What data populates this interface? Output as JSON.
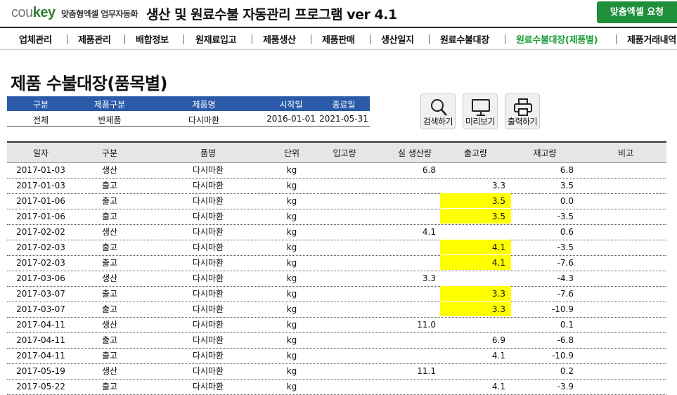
{
  "header": {
    "logo_a": "cou",
    "logo_b": "key",
    "logo_sub": "맞춤형엑셀 업무자동화",
    "app_title": "생산 및 원료수불 자동관리 프로그램 ver 4.1",
    "request_button": "맞춤엑셀 요청"
  },
  "nav": [
    {
      "label": "업체관리",
      "active": false
    },
    {
      "label": "제품관리",
      "active": false
    },
    {
      "label": "배합정보",
      "active": false
    },
    {
      "label": "원재료입고",
      "active": false
    },
    {
      "label": "제품생산",
      "active": false
    },
    {
      "label": "제품판매",
      "active": false
    },
    {
      "label": "생산일지",
      "active": false
    },
    {
      "label": "원료수불대장",
      "active": false
    },
    {
      "label": "원료수불대장(제품별)",
      "active": true
    },
    {
      "label": "제품거래내역",
      "active": false
    }
  ],
  "page_title": "제품 수불대장(품목별)",
  "filter": {
    "headers": [
      "구분",
      "제품구분",
      "제품명",
      "시작일",
      "종료일"
    ],
    "values": [
      "전체",
      "반제품",
      "다시마환",
      "2016-01-01",
      "2021-05-31"
    ]
  },
  "tools": {
    "search": "검색하기",
    "preview": "미리보기",
    "print": "출력하기"
  },
  "table": {
    "columns": [
      "일자",
      "구분",
      "품명",
      "단위",
      "입고량",
      "실 생산량",
      "출고량",
      "재고량",
      "비고"
    ],
    "highlight_color": "#ffff00",
    "rows": [
      {
        "date": "2017-01-03",
        "type": "생산",
        "name": "다시마환",
        "unit": "kg",
        "in": "",
        "prod": "6.8",
        "out": "",
        "stock": "6.8",
        "note": "",
        "hl": false
      },
      {
        "date": "2017-01-03",
        "type": "출고",
        "name": "다시마환",
        "unit": "kg",
        "in": "",
        "prod": "",
        "out": "3.3",
        "stock": "3.5",
        "note": "",
        "hl": false
      },
      {
        "date": "2017-01-06",
        "type": "출고",
        "name": "다시마환",
        "unit": "kg",
        "in": "",
        "prod": "",
        "out": "3.5",
        "stock": "0.0",
        "note": "",
        "hl": true
      },
      {
        "date": "2017-01-06",
        "type": "출고",
        "name": "다시마환",
        "unit": "kg",
        "in": "",
        "prod": "",
        "out": "3.5",
        "stock": "-3.5",
        "note": "",
        "hl": true
      },
      {
        "date": "2017-02-02",
        "type": "생산",
        "name": "다시마환",
        "unit": "kg",
        "in": "",
        "prod": "4.1",
        "out": "",
        "stock": "0.6",
        "note": "",
        "hl": false
      },
      {
        "date": "2017-02-03",
        "type": "출고",
        "name": "다시마환",
        "unit": "kg",
        "in": "",
        "prod": "",
        "out": "4.1",
        "stock": "-3.5",
        "note": "",
        "hl": true
      },
      {
        "date": "2017-02-03",
        "type": "출고",
        "name": "다시마환",
        "unit": "kg",
        "in": "",
        "prod": "",
        "out": "4.1",
        "stock": "-7.6",
        "note": "",
        "hl": true
      },
      {
        "date": "2017-03-06",
        "type": "생산",
        "name": "다시마환",
        "unit": "kg",
        "in": "",
        "prod": "3.3",
        "out": "",
        "stock": "-4.3",
        "note": "",
        "hl": false
      },
      {
        "date": "2017-03-07",
        "type": "출고",
        "name": "다시마환",
        "unit": "kg",
        "in": "",
        "prod": "",
        "out": "3.3",
        "stock": "-7.6",
        "note": "",
        "hl": true
      },
      {
        "date": "2017-03-07",
        "type": "출고",
        "name": "다시마환",
        "unit": "kg",
        "in": "",
        "prod": "",
        "out": "3.3",
        "stock": "-10.9",
        "note": "",
        "hl": true
      },
      {
        "date": "2017-04-11",
        "type": "생산",
        "name": "다시마환",
        "unit": "kg",
        "in": "",
        "prod": "11.0",
        "out": "",
        "stock": "0.1",
        "note": "",
        "hl": false
      },
      {
        "date": "2017-04-11",
        "type": "출고",
        "name": "다시마환",
        "unit": "kg",
        "in": "",
        "prod": "",
        "out": "6.9",
        "stock": "-6.8",
        "note": "",
        "hl": false
      },
      {
        "date": "2017-04-11",
        "type": "출고",
        "name": "다시마환",
        "unit": "kg",
        "in": "",
        "prod": "",
        "out": "4.1",
        "stock": "-10.9",
        "note": "",
        "hl": false
      },
      {
        "date": "2017-05-19",
        "type": "생산",
        "name": "다시마환",
        "unit": "kg",
        "in": "",
        "prod": "11.1",
        "out": "",
        "stock": "0.2",
        "note": "",
        "hl": false
      },
      {
        "date": "2017-05-22",
        "type": "출고",
        "name": "다시마환",
        "unit": "kg",
        "in": "",
        "prod": "",
        "out": "4.1",
        "stock": "-3.9",
        "note": "",
        "hl": false
      }
    ]
  }
}
